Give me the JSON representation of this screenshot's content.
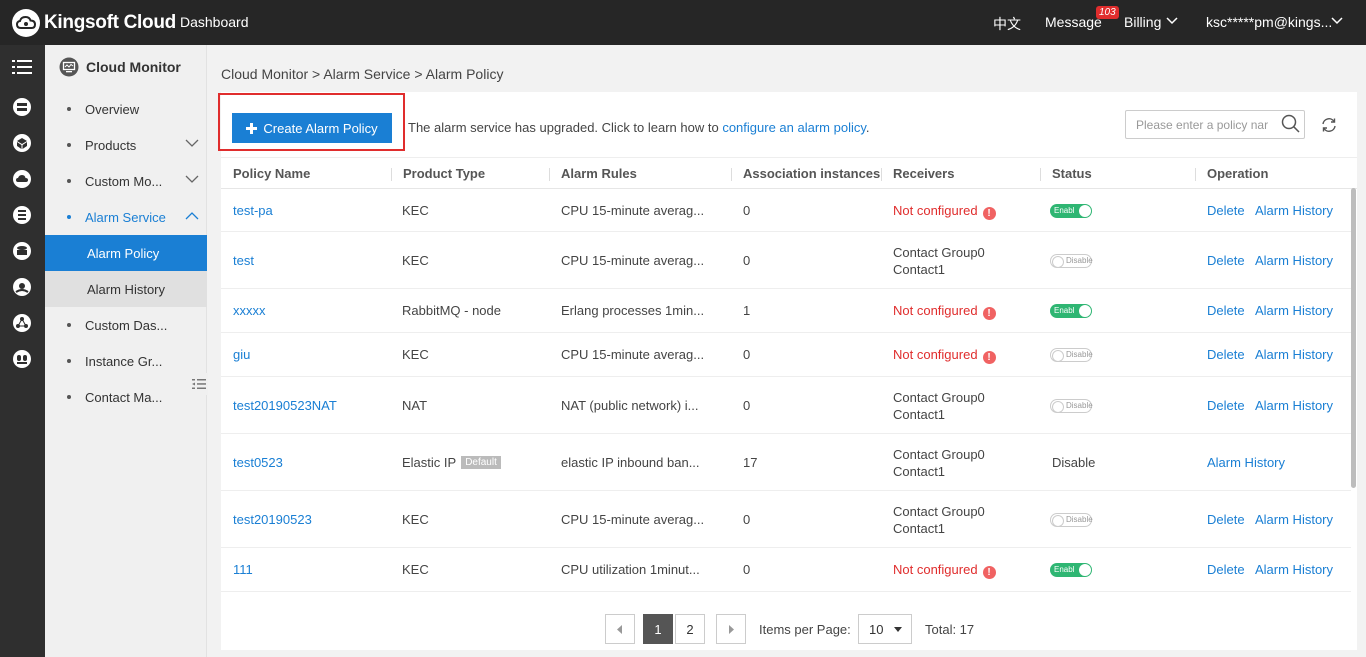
{
  "topbar": {
    "brand": "Kingsoft Cloud",
    "dashboard": "Dashboard",
    "language": "中文",
    "message_label": "Message",
    "message_count": "103",
    "billing": "Billing",
    "user": "ksc*****pm@kings..."
  },
  "rail_icons": [
    "menu-icon",
    "server-icon",
    "cube-icon",
    "cloud-icon",
    "database-icon",
    "storage-icon",
    "globe-icon",
    "network-icon",
    "group-icon"
  ],
  "subnav": {
    "title": "Cloud Monitor",
    "items": [
      {
        "label": "Overview"
      },
      {
        "label": "Products"
      },
      {
        "label": "Custom Mo..."
      },
      {
        "label": "Alarm Service"
      },
      {
        "label": "Alarm Policy"
      },
      {
        "label": "Alarm History"
      },
      {
        "label": "Custom Das..."
      },
      {
        "label": "Instance Gr..."
      },
      {
        "label": "Contact Ma..."
      }
    ]
  },
  "breadcrumb": "Cloud Monitor > Alarm Service > Alarm Policy",
  "toolbar": {
    "create_label": "Create Alarm Policy",
    "notice_text": "The alarm service has upgraded. Click to learn how to ",
    "notice_link": "configure an alarm policy",
    "notice_end": ".",
    "search_placeholder": "Please enter a policy nar"
  },
  "table": {
    "headers": [
      "Policy Name",
      "Product Type",
      "Alarm Rules",
      "Association instances",
      "Receivers",
      "Status",
      "Operation"
    ],
    "rows": [
      {
        "name": "test-pa",
        "product": "KEC",
        "tag": "",
        "rules": "CPU 15-minute averag...",
        "instances": "0",
        "receivers": [
          "Not configured"
        ],
        "not_configured": true,
        "status": "Enable",
        "ops": [
          "Delete",
          "Alarm History"
        ]
      },
      {
        "name": "test",
        "product": "KEC",
        "tag": "",
        "rules": "CPU 15-minute averag...",
        "instances": "0",
        "receivers": [
          "Contact Group0",
          "Contact1"
        ],
        "not_configured": false,
        "status": "Disable",
        "ops": [
          "Delete",
          "Alarm History"
        ]
      },
      {
        "name": "xxxxx",
        "product": "RabbitMQ - node",
        "tag": "",
        "rules": "Erlang processes 1min...",
        "instances": "1",
        "receivers": [
          "Not configured"
        ],
        "not_configured": true,
        "status": "Enable",
        "ops": [
          "Delete",
          "Alarm History"
        ]
      },
      {
        "name": "giu",
        "product": "KEC",
        "tag": "",
        "rules": "CPU 15-minute averag...",
        "instances": "0",
        "receivers": [
          "Not configured"
        ],
        "not_configured": true,
        "status": "Disable",
        "ops": [
          "Delete",
          "Alarm History"
        ]
      },
      {
        "name": "test20190523NAT",
        "product": "NAT",
        "tag": "",
        "rules": "NAT (public network) i...",
        "instances": "0",
        "receivers": [
          "Contact Group0",
          "Contact1"
        ],
        "not_configured": false,
        "status": "Disable",
        "ops": [
          "Delete",
          "Alarm History"
        ]
      },
      {
        "name": "test0523",
        "product": "Elastic IP",
        "tag": "Default",
        "rules": "elastic IP inbound ban...",
        "instances": "17",
        "receivers": [
          "Contact Group0",
          "Contact1"
        ],
        "not_configured": false,
        "status": "Disable",
        "status_text": "Disable",
        "ops": [
          "Alarm History"
        ]
      },
      {
        "name": "test20190523",
        "product": "KEC",
        "tag": "",
        "rules": "CPU 15-minute averag...",
        "instances": "0",
        "receivers": [
          "Contact Group0",
          "Contact1"
        ],
        "not_configured": false,
        "status": "Disable",
        "ops": [
          "Delete",
          "Alarm History"
        ]
      },
      {
        "name": "111",
        "product": "KEC",
        "tag": "",
        "rules": "CPU utilization 1minut...",
        "instances": "0",
        "receivers": [
          "Not configured"
        ],
        "not_configured": true,
        "status": "Enable",
        "ops": [
          "Delete",
          "Alarm History"
        ]
      }
    ]
  },
  "toggle_text": {
    "on": "Enabl",
    "off": "Disable"
  },
  "pagination": {
    "pages": [
      "1",
      "2"
    ],
    "current": "1",
    "items_label": "Items per Page:",
    "page_size": "10",
    "total_label": "Total: 17"
  },
  "colors": {
    "accent": "#1a7fd4",
    "danger": "#e02d2d",
    "enabled": "#2fb673",
    "topbar": "#262626",
    "rail": "#2f2f2f"
  }
}
